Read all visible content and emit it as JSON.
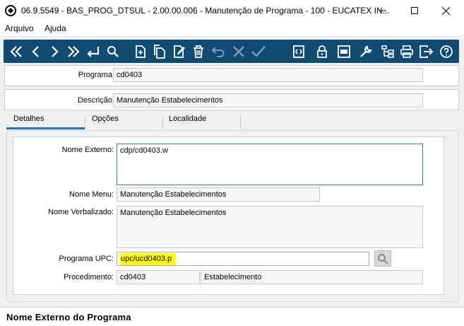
{
  "window": {
    "title": "06.9.5549 - BAS_PROG_DTSUL - 2.00.00.006 - Manutenção de Programa - 100 - EUCATEX IN..."
  },
  "menu": [
    "Arquivo",
    "Ajuda"
  ],
  "toolbar": {
    "icons": [
      "first-icon",
      "prev-icon",
      "next-icon",
      "last-icon",
      "goto-icon",
      "search-icon",
      "add-icon",
      "copy-icon",
      "edit-icon",
      "delete-icon",
      "undo-icon",
      "cancel-icon",
      "confirm-icon",
      "zoom-icon",
      "lock-icon",
      "pdf-icon",
      "tools-icon",
      "tree-icon",
      "print-icon",
      "exit-icon",
      "help-icon"
    ]
  },
  "header": {
    "programa_label": "Programa:",
    "programa_value": "cd0403",
    "descricao_label": "Descrição:",
    "descricao_value": "Manutenção Estabelecimentos"
  },
  "tabs": [
    "Detalhes",
    "Opções",
    "Localidade"
  ],
  "details": {
    "nome_externo_label": "Nome Externo:",
    "nome_externo_value": "cdp/cd0403.w",
    "nome_menu_label": "Nome Menu:",
    "nome_menu_value": "Manutenção Estabelecimentos",
    "nome_verbalizado_label": "Nome Verbalizado:",
    "nome_verbalizado_value": "Manutenção Estabelecimentos",
    "programa_upc_label": "Programa UPC:",
    "programa_upc_value": "upc/ucd0403.p",
    "procedimento_label": "Procedimento:",
    "procedimento_code": "cd0403",
    "procedimento_desc": "Estabelecimento"
  },
  "status": {
    "text": "Nome Externo do Programa"
  },
  "colors": {
    "toolbar_bg": "#0f4b72",
    "tab_accent": "#1a78c2",
    "upc_highlight": "#ffff00"
  }
}
